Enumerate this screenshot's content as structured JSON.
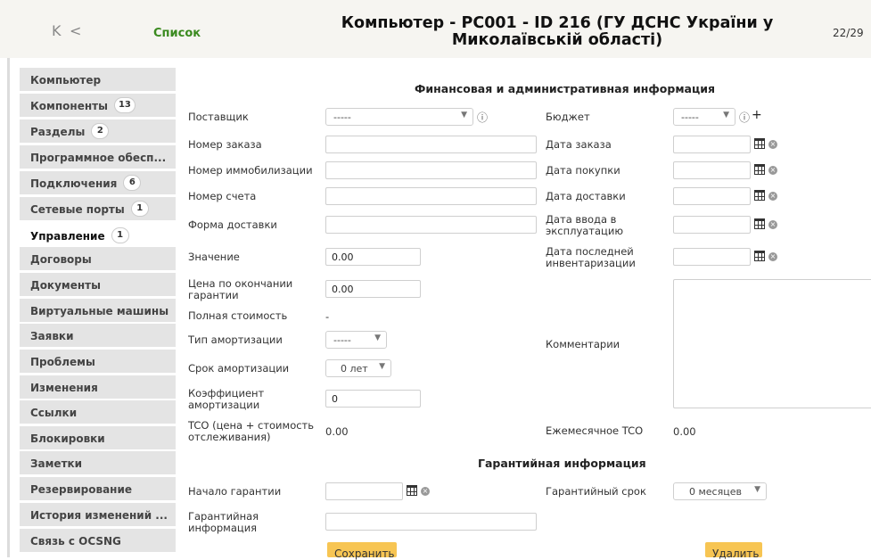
{
  "header": {
    "nav_first": "K",
    "nav_prev": "<",
    "list_link": "Список",
    "title": "Компьютер - PC001 - ID 216 (ГУ ДСНС України у Миколаївській області)",
    "counter": "22/29"
  },
  "sidebar": {
    "items": [
      {
        "label": "Компьютер",
        "badge": ""
      },
      {
        "label": "Компоненты",
        "badge": "13"
      },
      {
        "label": "Разделы",
        "badge": "2"
      },
      {
        "label": "Программное обесп...",
        "badge": ""
      },
      {
        "label": "Подключения",
        "badge": "6"
      },
      {
        "label": "Сетевые порты",
        "badge": "1"
      },
      {
        "label": "Управление",
        "badge": "1"
      },
      {
        "label": "Договоры",
        "badge": ""
      },
      {
        "label": "Документы",
        "badge": ""
      },
      {
        "label": "Виртуальные машины",
        "badge": ""
      },
      {
        "label": "Заявки",
        "badge": ""
      },
      {
        "label": "Проблемы",
        "badge": ""
      },
      {
        "label": "Изменения",
        "badge": ""
      },
      {
        "label": "Ссылки",
        "badge": ""
      },
      {
        "label": "Блокировки",
        "badge": ""
      },
      {
        "label": "Заметки",
        "badge": ""
      },
      {
        "label": "Резервирование",
        "badge": ""
      },
      {
        "label": "История изменений ...",
        "badge": ""
      },
      {
        "label": "Связь с OCSNG",
        "badge": ""
      }
    ],
    "active_index": 6
  },
  "financial": {
    "section_title": "Финансовая и административная информация",
    "supplier_label": "Поставщик",
    "supplier_value": "-----",
    "order_number_label": "Номер заказа",
    "order_number_value": "",
    "immobilization_label": "Номер иммобилизации",
    "immobilization_value": "",
    "invoice_label": "Номер счета",
    "invoice_value": "",
    "delivery_form_label": "Форма доставки",
    "delivery_form_value": "",
    "value_label": "Значение",
    "value_value": "0.00",
    "warranty_end_price_label": "Цена по окончании гарантии",
    "warranty_end_price_value": "0.00",
    "total_cost_label": "Полная стоимость",
    "total_cost_value": "-",
    "amortization_type_label": "Тип амортизации",
    "amortization_type_value": "-----",
    "amortization_period_label": "Срок амортизации",
    "amortization_period_value": "0 лет",
    "amortization_coef_label": "Коэффициент амортизации",
    "amortization_coef_value": "0",
    "tco_label": "TCO (цена + стоимость отслеживания)",
    "tco_value": "0.00",
    "budget_label": "Бюджет",
    "budget_value": "-----",
    "order_date_label": "Дата заказа",
    "purchase_date_label": "Дата покупки",
    "delivery_date_label": "Дата доставки",
    "commission_date_label": "Дата ввода в эксплуатацию",
    "inventory_date_label": "Дата последней инвентаризации",
    "comments_label": "Комментарии",
    "monthly_tco_label": "Ежемесячное TCO",
    "monthly_tco_value": "0.00"
  },
  "warranty": {
    "section_title": "Гарантийная информация",
    "start_label": "Начало гарантии",
    "info_label": "Гарантийная информация",
    "period_label": "Гарантийный срок",
    "period_value": "0 месяцев"
  },
  "actions": {
    "save_label": "Сохранить",
    "delete_label": "Удалить"
  },
  "icons": {
    "info": "info-icon",
    "add": "plus-icon",
    "calendar": "calendar-icon",
    "clear": "clear-icon"
  }
}
